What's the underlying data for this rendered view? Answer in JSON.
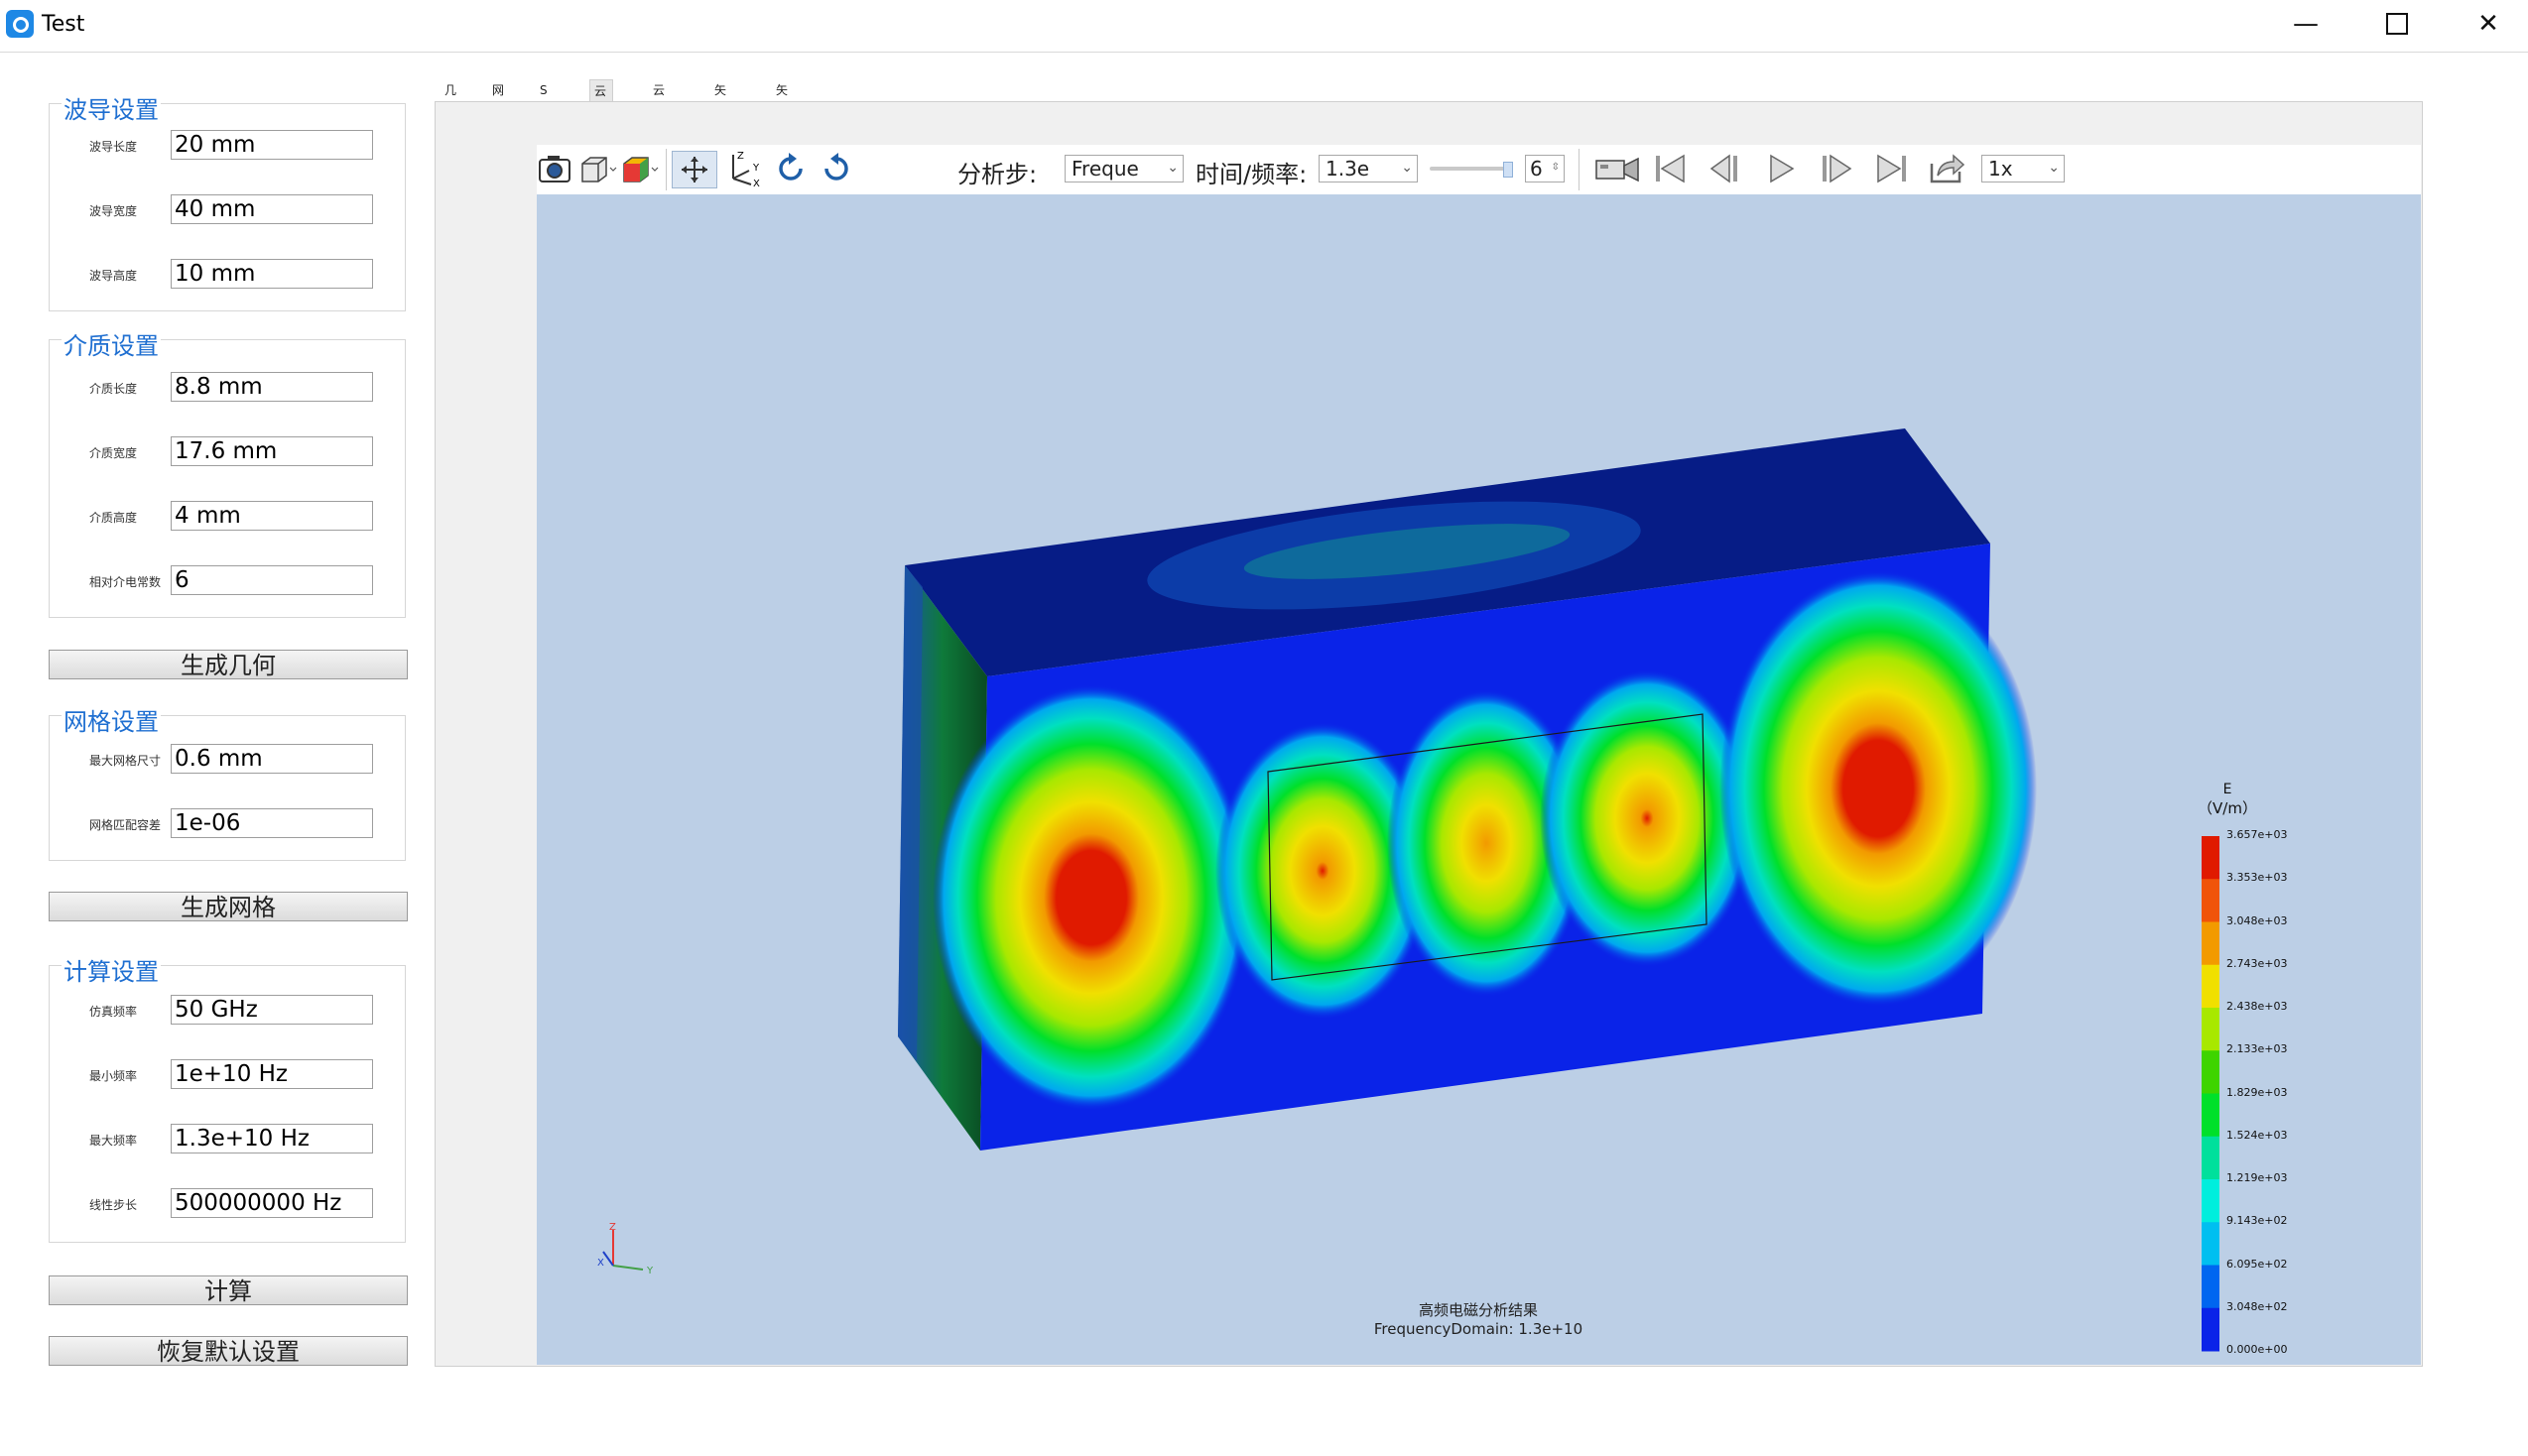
{
  "window": {
    "title": "Test"
  },
  "waveguide": {
    "title": "波导设置",
    "fields": [
      {
        "label": "波导长度",
        "value": "20 mm"
      },
      {
        "label": "波导宽度",
        "value": "40 mm"
      },
      {
        "label": "波导高度",
        "value": "10 mm"
      }
    ]
  },
  "dielectric": {
    "title": "介质设置",
    "fields": [
      {
        "label": "介质长度",
        "value": "8.8 mm"
      },
      {
        "label": "介质宽度",
        "value": "17.6 mm"
      },
      {
        "label": "介质高度",
        "value": "4 mm"
      },
      {
        "label": "相对介电常数",
        "value": "6"
      }
    ]
  },
  "buttons": {
    "generate_geometry": "生成几何",
    "generate_mesh": "生成网格",
    "compute": "计算",
    "restore_defaults": "恢复默认设置"
  },
  "mesh": {
    "title": "网格设置",
    "fields": [
      {
        "label": "最大网格尺寸",
        "value": "0.6 mm"
      },
      {
        "label": "网格匹配容差",
        "value": "1e-06"
      }
    ]
  },
  "compute": {
    "title": "计算设置",
    "fields": [
      {
        "label": "仿真频率",
        "value": "50 GHz"
      },
      {
        "label": "最小频率",
        "value": "1e+10 Hz"
      },
      {
        "label": "最大频率",
        "value": "1.3e+10 Hz"
      },
      {
        "label": "线性步长",
        "value": "500000000 Hz"
      }
    ]
  },
  "tabs": [
    "几何",
    "网格",
    "S参数",
    "云图_E",
    "云图_H",
    "矢量_E",
    "矢量_H"
  ],
  "active_tab": "云图_E",
  "toolbar": {
    "analysis_step_label": "分析步:",
    "analysis_step_value": "Freque",
    "time_freq_label": "时间/频率:",
    "time_freq_value": "1.3e",
    "slider_value": "6",
    "speed_value": "1x"
  },
  "legend": {
    "title": "E",
    "unit": "（V/m）",
    "labels": [
      "3.657e+03",
      "3.353e+03",
      "3.048e+03",
      "2.743e+03",
      "2.438e+03",
      "2.133e+03",
      "1.829e+03",
      "1.524e+03",
      "1.219e+03",
      "9.143e+02",
      "6.095e+02",
      "3.048e+02",
      "0.000e+00"
    ],
    "colors": [
      "#e01a00",
      "#f0540a",
      "#f29a00",
      "#f0e000",
      "#a8e800",
      "#3ed400",
      "#00e02a",
      "#00e09c",
      "#00eedd",
      "#00bff0",
      "#0066f0",
      "#0a23e8"
    ]
  },
  "caption": {
    "line1": "高频电磁分析结果",
    "line2": "FrequencyDomain: 1.3e+10"
  }
}
